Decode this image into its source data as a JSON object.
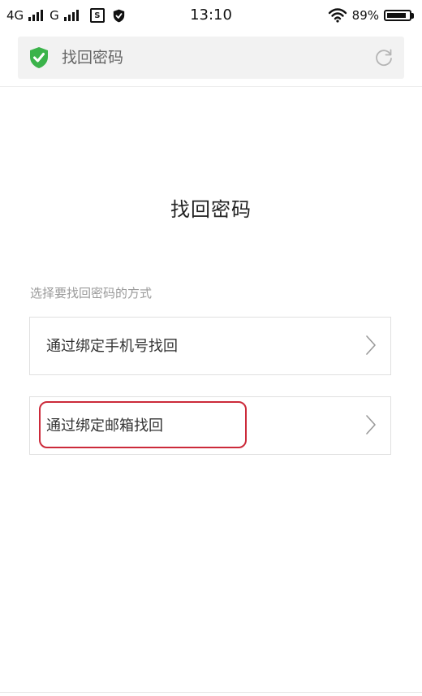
{
  "status_bar": {
    "network1": "4G",
    "network2": "G",
    "sim_label": "S",
    "time": "13:10",
    "battery_text": "89%",
    "battery_level": 0.89
  },
  "browser": {
    "page_title": "找回密码",
    "secure_color": "#3bb34a"
  },
  "main": {
    "title": "找回密码",
    "section_label": "选择要找回密码的方式",
    "options": [
      {
        "label": "通过绑定手机号找回",
        "icon": "chevron-right-icon"
      },
      {
        "label": "通过绑定邮箱找回",
        "icon": "chevron-right-icon",
        "highlighted": true
      }
    ],
    "highlight_color": "#cc2a3a"
  }
}
